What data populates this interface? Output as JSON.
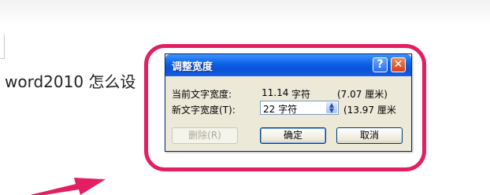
{
  "document": {
    "text": "word2010 怎么设"
  },
  "dialog": {
    "title": "调整宽度",
    "help_glyph": "?",
    "close_glyph": "✕",
    "current_width_label": "当前文字宽度:",
    "current_width_value": "11.14",
    "current_width_unit": "字符",
    "current_width_alt": "(7.07 厘米)",
    "new_width_label": "新文字宽度(T):",
    "new_width_value": "22 字符",
    "new_width_alt": "(13.97 厘米",
    "buttons": {
      "delete": "删除(R)",
      "ok": "确定",
      "cancel": "取消"
    }
  },
  "colors": {
    "highlight": "#e41e63",
    "titlebar": "#0b5fe6",
    "dialog_bg": "#ece9d8"
  },
  "icons": [
    "help-icon",
    "close-icon",
    "spin-arrows-icon",
    "arrow-icon"
  ]
}
